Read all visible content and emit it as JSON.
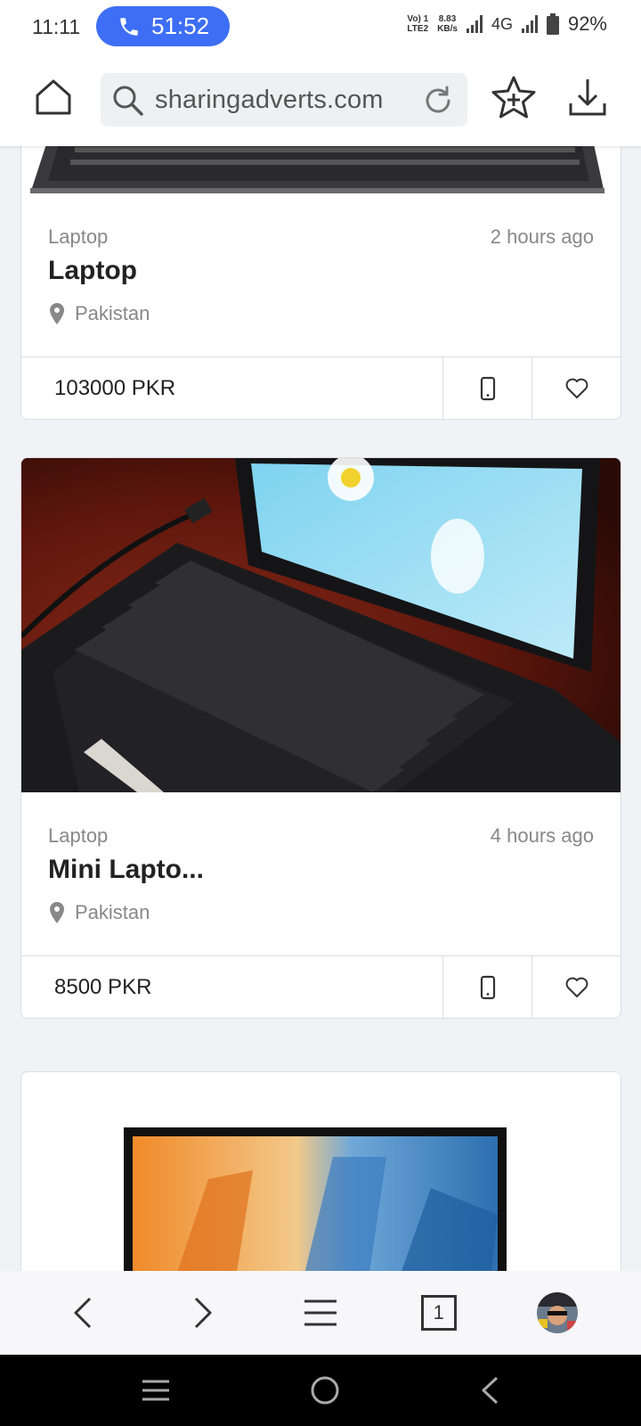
{
  "status_bar": {
    "time": "11:11",
    "call_duration": "51:52",
    "net_label_top": "Vo) 1",
    "net_label_bottom": "LTE2",
    "speed_value": "8.83",
    "speed_unit": "KB/s",
    "network_type": "4G",
    "battery": "92%"
  },
  "browser": {
    "url": "sharingadverts.com",
    "tab_count": "1"
  },
  "listings": [
    {
      "category": "Laptop",
      "time": "2 hours ago",
      "title": "Laptop",
      "location": "Pakistan",
      "price": "103000 PKR"
    },
    {
      "category": "Laptop",
      "time": "4 hours ago",
      "title": "Mini Lapto...",
      "location": "Pakistan",
      "price": "8500 PKR"
    }
  ],
  "colors": {
    "accent": "#3d6ef5",
    "background": "#f1f2f6",
    "muted_text": "#888888"
  }
}
